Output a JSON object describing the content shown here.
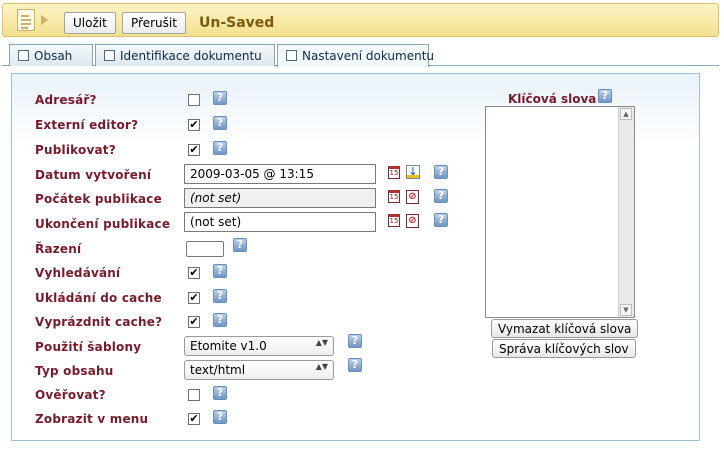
{
  "toolbar": {
    "save_label": "Uložit",
    "cancel_label": "Přerušit",
    "status_title": "Un-Saved"
  },
  "tabs": [
    {
      "label": "Obsah",
      "active": false
    },
    {
      "label": "Identifikace dokumentu",
      "active": false
    },
    {
      "label": "Nastavení dokumentu",
      "active": true
    }
  ],
  "settings": {
    "folder_label": "Adresář?",
    "folder_checked": false,
    "rich_editor_label": "Externí editor?",
    "rich_editor_checked": true,
    "published_label": "Publikovat?",
    "published_checked": true,
    "created_label": "Datum vytvoření",
    "created_value": "2009-03-05 @ 13:15",
    "pub_start_label": "Počátek publikace",
    "pub_start_value": "(not set)",
    "pub_end_label": "Ukončení publikace",
    "pub_end_value": "(not set)",
    "order_label": "Řazení",
    "order_value": "",
    "searchable_label": "Vyhledávání",
    "searchable_checked": true,
    "cacheable_label": "Ukládání do cache",
    "cacheable_checked": true,
    "clear_cache_label": "Vyprázdnit cache?",
    "clear_cache_checked": true,
    "template_label": "Použití šablony",
    "template_value": "Etomite v1.0",
    "content_type_label": "Typ obsahu",
    "content_type_value": "text/html",
    "authenticate_label": "Ověřovat?",
    "authenticate_checked": false,
    "show_in_menu_label": "Zobrazit v menu",
    "show_in_menu_checked": true
  },
  "keywords": {
    "title": "Klíčová slova",
    "clear_button": "Vymazat klíčová slova",
    "manage_button": "Správa klíčových slov"
  },
  "icons": {
    "help": "help-icon",
    "calendar": "calendar-icon",
    "set_now": "set-now-icon",
    "clear_date": "clear-date-icon",
    "document": "document-icon"
  },
  "colors": {
    "label": "#7a1a2a",
    "toolbar_bg": "#f3e18f",
    "title": "#7a5a10",
    "help": "#6f96c6"
  },
  "symbols": {
    "check": "✔",
    "help": "?",
    "calendar": "15",
    "set_now": "↓",
    "clear_date": "⊘",
    "select_arrows": "▲▼",
    "scroll_up": "▲",
    "scroll_down": "▼"
  }
}
